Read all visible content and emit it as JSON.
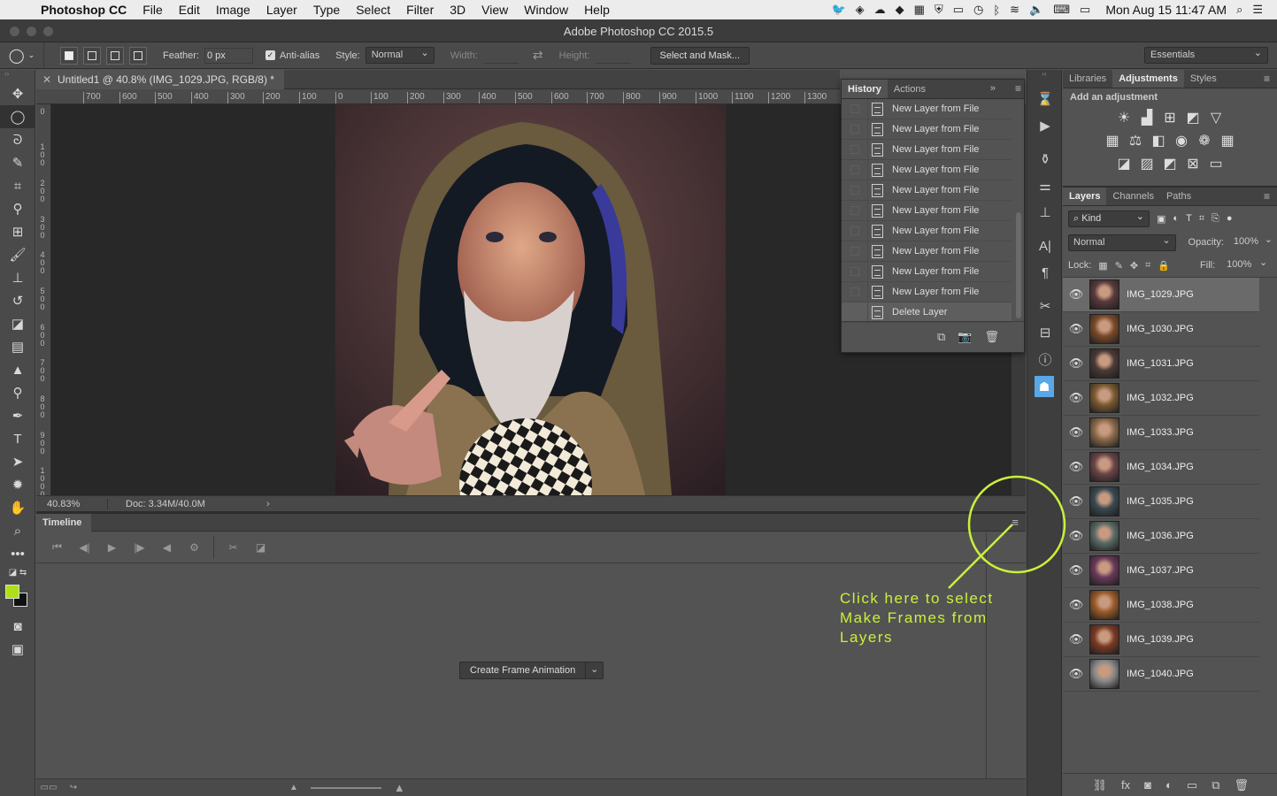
{
  "menubar": {
    "app_name": "Photoshop CC",
    "items": [
      "File",
      "Edit",
      "Image",
      "Layer",
      "Type",
      "Select",
      "Filter",
      "3D",
      "View",
      "Window",
      "Help"
    ],
    "clock": "Mon Aug 15  11:47 AM"
  },
  "window": {
    "title": "Adobe Photoshop CC 2015.5"
  },
  "options": {
    "feather_label": "Feather:",
    "feather_value": "0 px",
    "antialias_label": "Anti-alias",
    "style_label": "Style:",
    "style_value": "Normal",
    "width_label": "Width:",
    "height_label": "Height:",
    "select_mask_label": "Select and Mask...",
    "workspace": "Essentials"
  },
  "document": {
    "tab_title": "Untitled1 @ 40.8% (IMG_1029.JPG, RGB/8) *",
    "ruler_h": [
      "700",
      "600",
      "500",
      "400",
      "300",
      "200",
      "100",
      "0",
      "100",
      "200",
      "300",
      "400",
      "500",
      "600",
      "700",
      "800",
      "900",
      "1000",
      "1100",
      "1200",
      "1300"
    ],
    "ruler_v": [
      "0",
      "100",
      "200",
      "300",
      "400",
      "500",
      "600",
      "700",
      "800",
      "900",
      "1000"
    ],
    "zoom": "40.83%",
    "doc_size": "Doc: 3.34M/40.0M"
  },
  "timeline": {
    "title": "Timeline",
    "create_button": "Create Frame Animation"
  },
  "history": {
    "tabs": [
      "History",
      "Actions"
    ],
    "items": [
      "New Layer from File",
      "New Layer from File",
      "New Layer from File",
      "New Layer from File",
      "New Layer from File",
      "New Layer from File",
      "New Layer from File",
      "New Layer from File",
      "New Layer from File",
      "New Layer from File",
      "Delete Layer"
    ]
  },
  "panels": {
    "adjust_tabs": [
      "Libraries",
      "Adjustments",
      "Styles"
    ],
    "adjust_sub": "Add an adjustment",
    "layer_tabs": [
      "Layers",
      "Channels",
      "Paths"
    ],
    "kind_label": "Kind",
    "blend_mode": "Normal",
    "opacity_label": "Opacity:",
    "opacity_value": "100%",
    "lock_label": "Lock:",
    "fill_label": "Fill:",
    "fill_value": "100%"
  },
  "layers": [
    {
      "name": "IMG_1029.JPG",
      "color": "#5a3a3e"
    },
    {
      "name": "IMG_1030.JPG",
      "color": "#7a4a2a"
    },
    {
      "name": "IMG_1031.JPG",
      "color": "#4a3a36"
    },
    {
      "name": "IMG_1032.JPG",
      "color": "#7a5a32"
    },
    {
      "name": "IMG_1033.JPG",
      "color": "#8a6a4a"
    },
    {
      "name": "IMG_1034.JPG",
      "color": "#6a4448"
    },
    {
      "name": "IMG_1035.JPG",
      "color": "#3a4a52"
    },
    {
      "name": "IMG_1036.JPG",
      "color": "#5a6a66"
    },
    {
      "name": "IMG_1037.JPG",
      "color": "#6a3a5a"
    },
    {
      "name": "IMG_1038.JPG",
      "color": "#9a5a2a"
    },
    {
      "name": "IMG_1039.JPG",
      "color": "#7a3a24"
    },
    {
      "name": "IMG_1040.JPG",
      "color": "#8a8a8a"
    }
  ],
  "annotation": "Click here to select\nMake Frames from\nLayers",
  "colors": {
    "foreground": "#b0e014",
    "background": "#111111",
    "annotation": "#c9f03a"
  }
}
